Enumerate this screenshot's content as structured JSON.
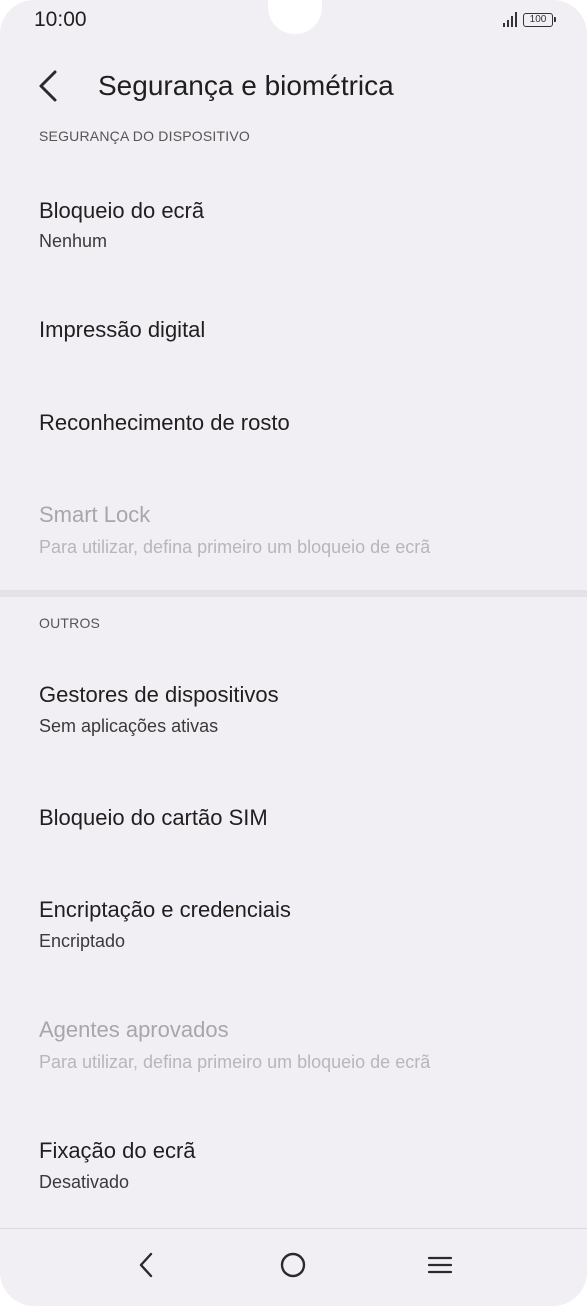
{
  "status_bar": {
    "time": "10:00",
    "battery": "100"
  },
  "header": {
    "title": "Segurança e biométrica"
  },
  "sections": {
    "device_security": {
      "label": "SEGURANÇA DO DISPOSITIVO",
      "items": [
        {
          "title": "Bloqueio do ecrã",
          "subtitle": "Nenhum",
          "enabled": true
        },
        {
          "title": "Impressão digital",
          "subtitle": "",
          "enabled": true
        },
        {
          "title": "Reconhecimento de rosto",
          "subtitle": "",
          "enabled": true
        },
        {
          "title": "Smart Lock",
          "subtitle": "Para utilizar, defina primeiro um bloqueio de ecrã",
          "enabled": false
        }
      ]
    },
    "others": {
      "label": "OUTROS",
      "items": [
        {
          "title": "Gestores de dispositivos",
          "subtitle": "Sem aplicações ativas",
          "enabled": true
        },
        {
          "title": "Bloqueio do cartão SIM",
          "subtitle": "",
          "enabled": true
        },
        {
          "title": "Encriptação e credenciais",
          "subtitle": "Encriptado",
          "enabled": true
        },
        {
          "title": "Agentes aprovados",
          "subtitle": "Para utilizar, defina primeiro um bloqueio de ecrã",
          "enabled": false
        },
        {
          "title": "Fixação do ecrã",
          "subtitle": "Desativado",
          "enabled": true
        }
      ]
    }
  },
  "icons": {
    "back": "chevron-left-icon",
    "nav_back": "nav-back-icon",
    "nav_home": "nav-home-icon",
    "nav_menu": "nav-menu-icon"
  }
}
